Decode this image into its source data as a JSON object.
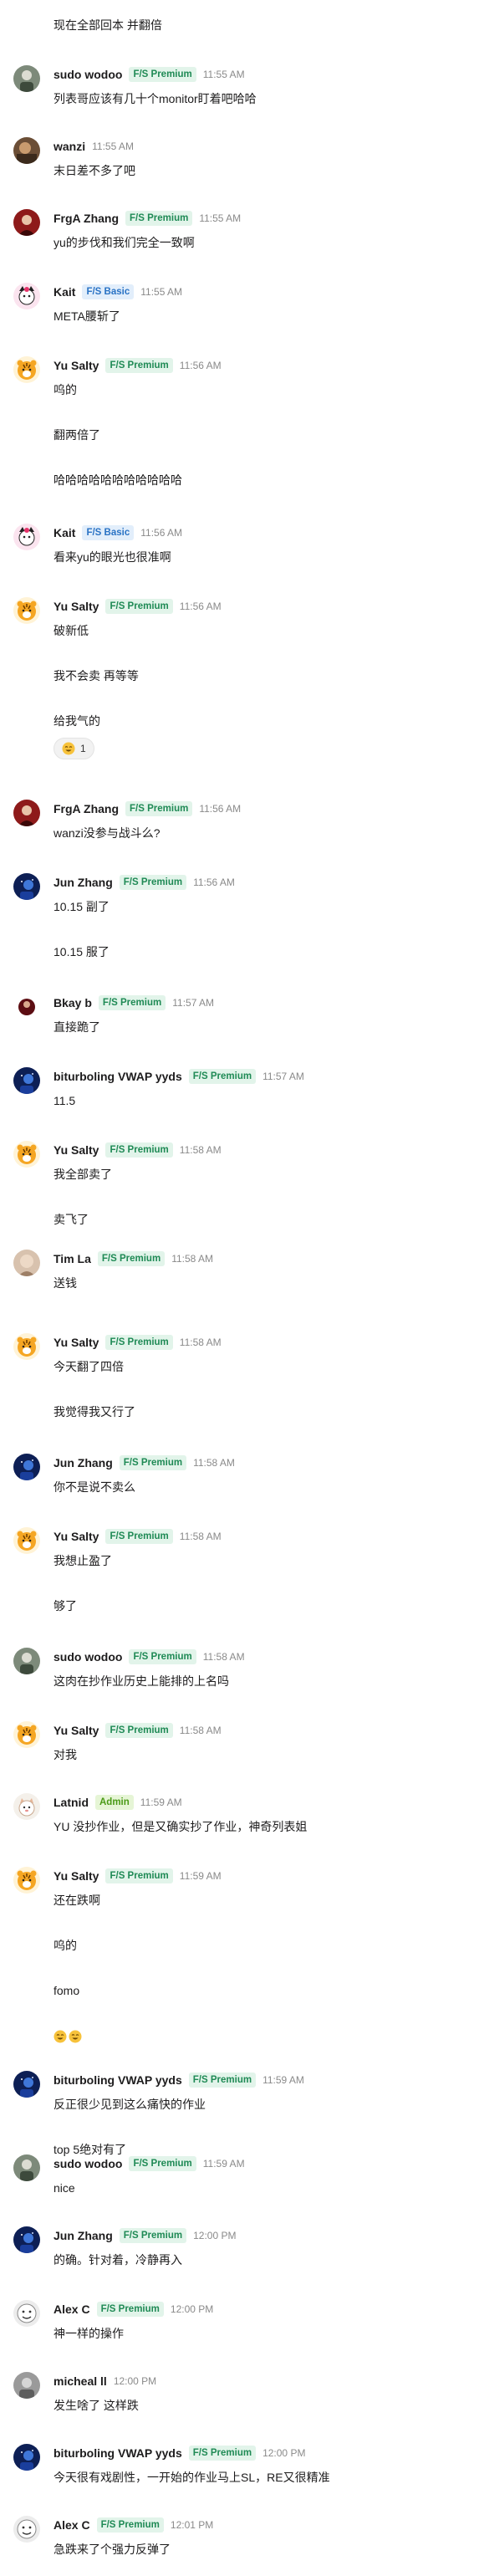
{
  "top_line": "现在全部回本 并翻倍",
  "reaction_counts": [
    "1"
  ],
  "messages": [
    {
      "user": "sudo wodoo",
      "badge": "F/S Premium",
      "badge_type": "premium",
      "time": "11:55 AM",
      "avatar": "gray-figure",
      "lines": [
        "列表哥应该有几十个monitor盯着吧哈哈"
      ]
    },
    {
      "user": "wanzi",
      "badge": "",
      "badge_type": "",
      "time": "11:55 AM",
      "avatar": "brown-photo",
      "lines": [
        "末日差不多了吧"
      ]
    },
    {
      "user": "FrgA Zhang",
      "badge": "F/S Premium",
      "badge_type": "premium",
      "time": "11:55 AM",
      "avatar": "red-figure",
      "lines": [
        "yu的步伐和我们完全一致啊"
      ]
    },
    {
      "user": "Kait",
      "badge": "F/S Basic",
      "badge_type": "basic",
      "time": "11:55 AM",
      "avatar": "pink-cat",
      "lines": [
        "META腰斩了"
      ]
    },
    {
      "user": "Yu Salty",
      "badge": "F/S Premium",
      "badge_type": "premium",
      "time": "11:56 AM",
      "avatar": "tiger",
      "lines": [
        "呜的",
        "翻两倍了",
        "哈哈哈哈哈哈哈哈哈哈哈"
      ]
    },
    {
      "user": "Kait",
      "badge": "F/S Basic",
      "badge_type": "basic",
      "time": "11:56 AM",
      "avatar": "pink-cat",
      "lines": [
        "看来yu的眼光也很准啊"
      ]
    },
    {
      "user": "Yu Salty",
      "badge": "F/S Premium",
      "badge_type": "premium",
      "time": "11:56 AM",
      "avatar": "tiger",
      "lines": [
        "破新低",
        "我不会卖 再等等",
        "给我气的"
      ],
      "reaction": true
    },
    {
      "user": "FrgA Zhang",
      "badge": "F/S Premium",
      "badge_type": "premium",
      "time": "11:56 AM",
      "avatar": "red-figure",
      "lines": [
        "wanzi没参与战斗么?"
      ]
    },
    {
      "user": "Jun Zhang",
      "badge": "F/S Premium",
      "badge_type": "premium",
      "time": "11:56 AM",
      "avatar": "blue-night",
      "lines": [
        "10.15 副了",
        "10.15 服了"
      ]
    },
    {
      "user": "Bkay b",
      "badge": "F/S Premium",
      "badge_type": "premium",
      "time": "11:57 AM",
      "avatar": "dark-red",
      "lines": [
        "直接跪了"
      ]
    },
    {
      "user": "biturboling VWAP yyds",
      "badge": "F/S Premium",
      "badge_type": "premium",
      "time": "11:57 AM",
      "avatar": "blue-night",
      "lines": [
        "11.5"
      ]
    },
    {
      "user": "Yu Salty",
      "badge": "F/S Premium",
      "badge_type": "premium",
      "time": "11:58 AM",
      "avatar": "tiger",
      "lines": [
        "我全部卖了",
        "卖飞了"
      ]
    },
    {
      "user": "Tim La",
      "badge": "F/S Premium",
      "badge_type": "premium",
      "time": "11:58 AM",
      "avatar": "tan-face",
      "lines": [
        "送钱"
      ]
    },
    {
      "user": "Yu Salty",
      "badge": "F/S Premium",
      "badge_type": "premium",
      "time": "11:58 AM",
      "avatar": "tiger",
      "lines": [
        "今天翻了四倍",
        "我觉得我又行了"
      ]
    },
    {
      "user": "Jun Zhang",
      "badge": "F/S Premium",
      "badge_type": "premium",
      "time": "11:58 AM",
      "avatar": "blue-night",
      "lines": [
        "你不是说不卖么"
      ]
    },
    {
      "user": "Yu Salty",
      "badge": "F/S Premium",
      "badge_type": "premium",
      "time": "11:58 AM",
      "avatar": "tiger",
      "lines": [
        "我想止盈了",
        "够了"
      ]
    },
    {
      "user": "sudo wodoo",
      "badge": "F/S Premium",
      "badge_type": "premium",
      "time": "11:58 AM",
      "avatar": "gray-figure",
      "lines": [
        "这肉在抄作业历史上能排的上名吗"
      ]
    },
    {
      "user": "Yu Salty",
      "badge": "F/S Premium",
      "badge_type": "premium",
      "time": "11:58 AM",
      "avatar": "tiger",
      "lines": [
        "对我"
      ]
    },
    {
      "user": "Latnid",
      "badge": "Admin",
      "badge_type": "admin",
      "time": "11:59 AM",
      "avatar": "white-cat",
      "lines": [
        "YU 没抄作业，但是又确实抄了作业，神奇列表姐"
      ]
    },
    {
      "user": "Yu Salty",
      "badge": "F/S Premium",
      "badge_type": "premium",
      "time": "11:59 AM",
      "avatar": "tiger",
      "lines": [
        "还在跌啊",
        "呜的",
        "fomo"
      ],
      "emoji_line": true
    },
    {
      "user": "biturboling VWAP yyds",
      "badge": "F/S Premium",
      "badge_type": "premium",
      "time": "11:59 AM",
      "avatar": "blue-night",
      "lines": [
        "反正很少见到这么痛快的作业",
        "top 5绝对有了"
      ]
    },
    {
      "user": "sudo wodoo",
      "badge": "F/S Premium",
      "badge_type": "premium",
      "time": "11:59 AM",
      "avatar": "gray-figure",
      "lines": [
        "nice"
      ]
    },
    {
      "user": "Jun Zhang",
      "badge": "F/S Premium",
      "badge_type": "premium",
      "time": "12:00 PM",
      "avatar": "blue-night",
      "lines": [
        "的确。针对着，冷静再入"
      ]
    },
    {
      "user": "Alex C",
      "badge": "F/S Premium",
      "badge_type": "premium",
      "time": "12:00 PM",
      "avatar": "white-face",
      "lines": [
        "神一样的操作"
      ]
    },
    {
      "user": "micheal ll",
      "badge": "",
      "badge_type": "",
      "time": "12:00 PM",
      "avatar": "gray-photo",
      "lines": [
        "发生啥了 这样跌"
      ]
    },
    {
      "user": "biturboling VWAP yyds",
      "badge": "F/S Premium",
      "badge_type": "premium",
      "time": "12:00 PM",
      "avatar": "blue-night",
      "lines": [
        "今天很有戏剧性，一开始的作业马上SL，RE又很精准"
      ]
    },
    {
      "user": "Alex C",
      "badge": "F/S Premium",
      "badge_type": "premium",
      "time": "12:01 PM",
      "avatar": "white-face",
      "lines": [
        "急跌来了个强力反弹了"
      ]
    }
  ]
}
